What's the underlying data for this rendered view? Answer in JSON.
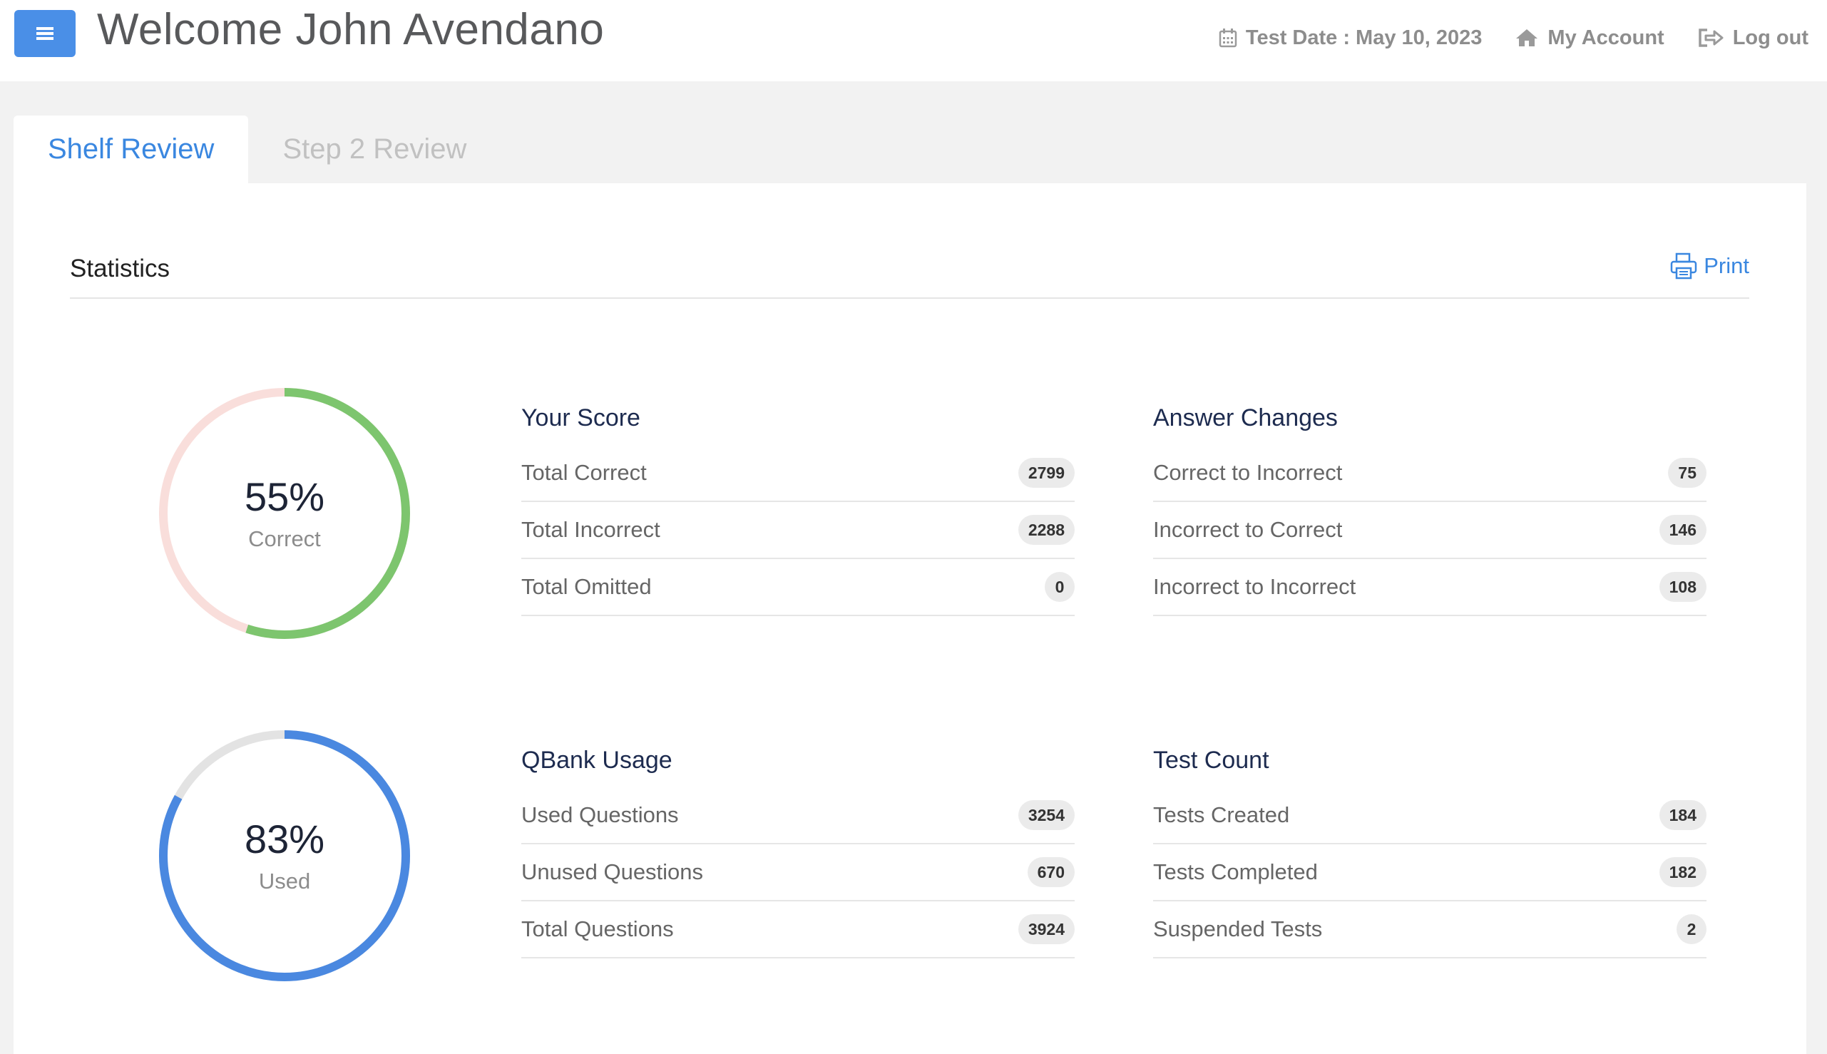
{
  "header": {
    "welcome": "Welcome John Avendano",
    "test_date": "Test Date : May 10, 2023",
    "my_account": "My Account",
    "logout": "Log out"
  },
  "tabs": [
    {
      "label": "Shelf Review",
      "active": true
    },
    {
      "label": "Step 2 Review",
      "active": false
    }
  ],
  "statistics": {
    "title": "Statistics",
    "print_label": "Print"
  },
  "donuts": [
    {
      "percent_text": "55%",
      "label": "Correct",
      "fraction": 0.55,
      "fill_color": "#7dc56e",
      "track_color": "#f9dedb"
    },
    {
      "percent_text": "83%",
      "label": "Used",
      "fraction": 0.83,
      "fill_color": "#4a88e0",
      "track_color": "#e3e3e3"
    }
  ],
  "groups": {
    "score": {
      "title": "Your Score",
      "rows": [
        {
          "label": "Total Correct",
          "value": "2799"
        },
        {
          "label": "Total Incorrect",
          "value": "2288"
        },
        {
          "label": "Total Omitted",
          "value": "0"
        }
      ]
    },
    "answer_changes": {
      "title": "Answer Changes",
      "rows": [
        {
          "label": "Correct to Incorrect",
          "value": "75"
        },
        {
          "label": "Incorrect to Correct",
          "value": "146"
        },
        {
          "label": "Incorrect to Incorrect",
          "value": "108"
        }
      ]
    },
    "qbank": {
      "title": "QBank Usage",
      "rows": [
        {
          "label": "Used Questions",
          "value": "3254"
        },
        {
          "label": "Unused Questions",
          "value": "670"
        },
        {
          "label": "Total Questions",
          "value": "3924"
        }
      ]
    },
    "test_count": {
      "title": "Test Count",
      "rows": [
        {
          "label": "Tests Created",
          "value": "184"
        },
        {
          "label": "Tests Completed",
          "value": "182"
        },
        {
          "label": "Suspended Tests",
          "value": "2"
        }
      ]
    }
  },
  "colors": {
    "accent": "#3a87e0",
    "menu_button": "#4a8fe7"
  },
  "icons": {
    "menu": "hamburger-icon",
    "calendar": "calendar-icon",
    "home": "home-icon",
    "logout": "logout-icon",
    "print": "printer-icon"
  }
}
